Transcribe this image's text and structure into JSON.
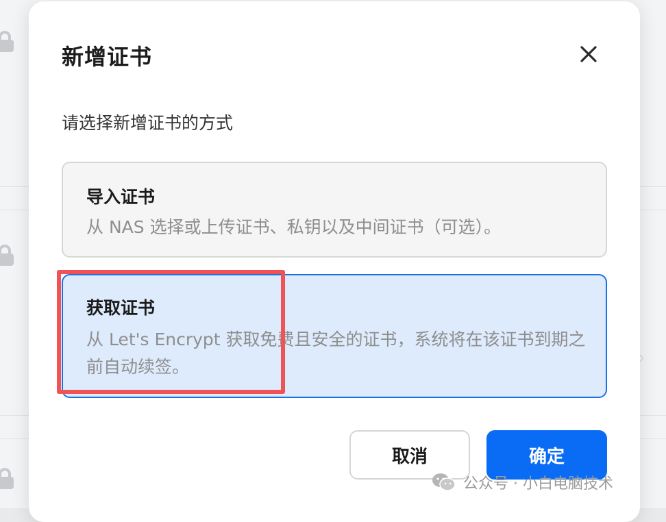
{
  "dialog": {
    "title": "新增证书",
    "subtitle": "请选择新增证书的方式",
    "options": [
      {
        "title": "导入证书",
        "description": "从 NAS 选择或上传证书、私钥以及中间证书（可选）。",
        "selected": false
      },
      {
        "title": "获取证书",
        "description": "从 Let's Encrypt 获取免费且安全的证书，系统将在该证书到期之前自动续签。",
        "selected": true
      }
    ],
    "buttons": {
      "cancel": "取消",
      "confirm": "确定"
    }
  },
  "watermark": {
    "text": "公众号 · 小白电脑技术"
  },
  "colors": {
    "primary": "#0a6cf5",
    "selected_bg": "#deebfc",
    "highlight": "#ef5356"
  },
  "icons": {
    "close": "close-icon",
    "background": "lock-icon",
    "watermark": "wechat-icon"
  }
}
